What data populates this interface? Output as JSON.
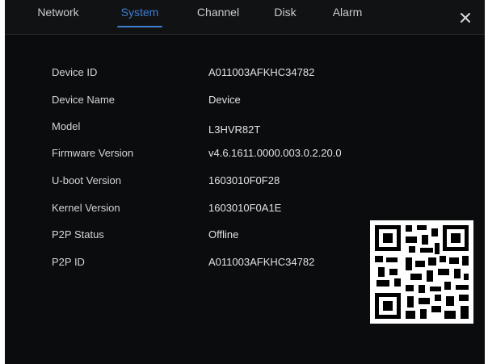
{
  "tabs": [
    {
      "label": "Network"
    },
    {
      "label": "System"
    },
    {
      "label": "Channel"
    },
    {
      "label": "Disk"
    },
    {
      "label": "Alarm"
    }
  ],
  "active_tab": "System",
  "close_icon": "close-icon",
  "info": [
    {
      "label": "Device ID",
      "value": "A011003AFKHC34782"
    },
    {
      "label": "Device Name",
      "value": "Device"
    },
    {
      "label": "Model",
      "value": "L3HVR82T"
    },
    {
      "label": "Firmware Version",
      "value": "v4.6.1611.0000.003.0.2.20.0"
    },
    {
      "label": "U-boot Version",
      "value": "1603010F0F28"
    },
    {
      "label": "Kernel Version",
      "value": "1603010F0A1E"
    },
    {
      "label": "P2P Status",
      "value": "Offline"
    },
    {
      "label": "P2P ID",
      "value": "A011003AFKHC34782"
    }
  ],
  "qr_icon": "qr-code-icon",
  "colors": {
    "accent": "#3d7fd0",
    "background": "#0b0c0e"
  }
}
